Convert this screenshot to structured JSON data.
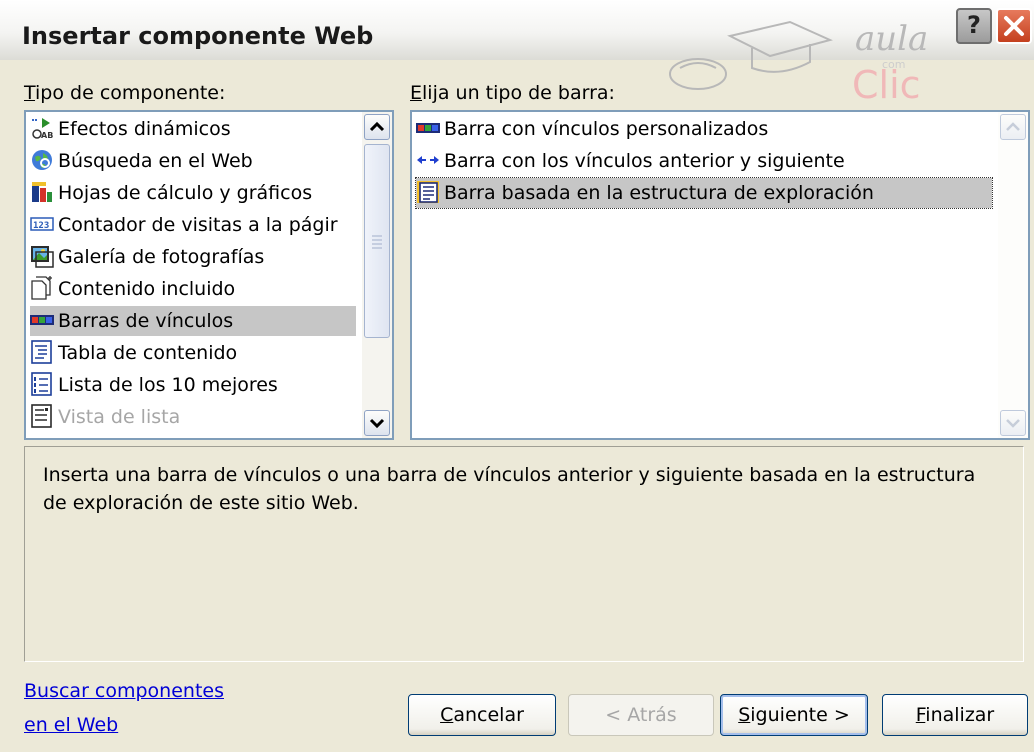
{
  "window": {
    "title": "Insertar componente Web",
    "help_glyph": "?"
  },
  "watermark": {
    "line1": "aula",
    "line2": "Clic",
    "small": "com"
  },
  "left_panel": {
    "label_underlined": "T",
    "label_rest": "ipo de componente:",
    "items": [
      {
        "label": "Efectos dinámicos",
        "icon": "dynamic-effects-icon"
      },
      {
        "label": "Búsqueda en el Web",
        "icon": "web-search-icon"
      },
      {
        "label": "Hojas de cálculo y gráficos",
        "icon": "spreadsheet-charts-icon"
      },
      {
        "label": "Contador de visitas a la págir",
        "icon": "hit-counter-icon"
      },
      {
        "label": "Galería de fotografías",
        "icon": "photo-gallery-icon"
      },
      {
        "label": "Contenido incluido",
        "icon": "included-content-icon"
      },
      {
        "label": "Barras de vínculos",
        "icon": "link-bar-icon",
        "selected": true
      },
      {
        "label": "Tabla de contenido",
        "icon": "table-of-contents-icon"
      },
      {
        "label": "Lista de los 10 mejores",
        "icon": "top-ten-list-icon"
      },
      {
        "label": "Vista de lista",
        "icon": "list-view-icon",
        "disabled": true
      }
    ]
  },
  "right_panel": {
    "label_underlined": "E",
    "label_rest": "lija un tipo de barra:",
    "items": [
      {
        "label": "Barra con vínculos personalizados",
        "icon": "custom-link-bar-icon"
      },
      {
        "label": "Barra con los vínculos anterior y siguiente",
        "icon": "back-next-arrows-icon"
      },
      {
        "label": "Barra basada en la estructura de exploración",
        "icon": "navigation-structure-icon",
        "selected": true
      }
    ]
  },
  "description": "Inserta una barra de vínculos o una barra de vínculos anterior y siguiente basada en la estructura de exploración de este sitio Web.",
  "find_link": {
    "line1": "Buscar componentes",
    "line2": "en el Web"
  },
  "buttons": {
    "cancel": {
      "u": "C",
      "rest": "ancelar"
    },
    "back": "< Atrás",
    "next": {
      "u": "S",
      "rest": "iguiente >"
    },
    "finish": {
      "u": "F",
      "rest": "inalizar"
    }
  },
  "colors": {
    "selection": "#c6c6c6",
    "link": "#0000d6",
    "dialog_bg": "#ece9d8",
    "list_border": "#7f9db9"
  }
}
